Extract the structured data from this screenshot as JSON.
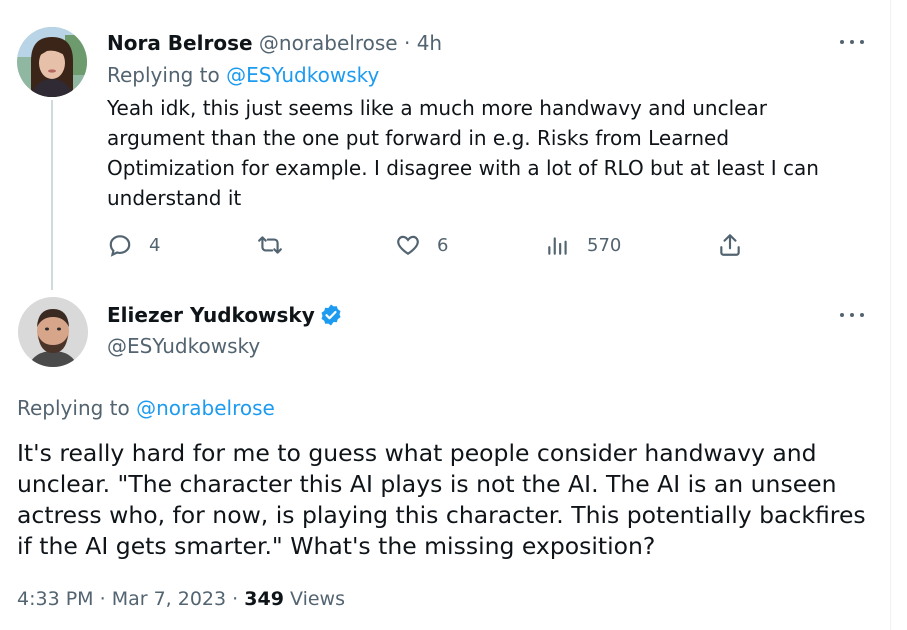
{
  "reply_tweet": {
    "author_name": "Nora Belrose",
    "author_handle": "@norabelrose",
    "separator": "·",
    "time_ago": "4h",
    "replying_prefix": "Replying to ",
    "replying_to": "@ESYudkowsky",
    "text": "Yeah idk, this just seems like a much more handwavy and unclear argument than the one put forward in e.g. Risks from Learned Optimization for example. I disagree with a lot of RLO but at least I can understand it",
    "replies": "4",
    "likes": "6",
    "views": "570",
    "icons": [
      "reply-icon",
      "retweet-icon",
      "like-icon",
      "views-icon",
      "share-icon",
      "more-icon"
    ]
  },
  "main_tweet": {
    "author_name": "Eliezer Yudkowsky",
    "author_handle": "@ESYudkowsky",
    "verified_icon": "verified-badge-icon",
    "replying_prefix": "Replying to ",
    "replying_to": "@norabelrose",
    "text": "It's really hard for me to guess what people consider handwavy and unclear.  \"The character this AI plays is not the AI.  The AI is an unseen actress who, for now, is playing this character.  This potentially backfires if the AI gets smarter.\"  What's the missing exposition?",
    "time": "4:33 PM",
    "separator": "·",
    "date": "Mar 7, 2023",
    "separator_2": "·",
    "views_count": "349",
    "views_label": "Views"
  },
  "colors": {
    "accent": "#1d9bf0",
    "muted": "#536471",
    "text": "#0f1419",
    "thread_line": "#cfd9de"
  }
}
